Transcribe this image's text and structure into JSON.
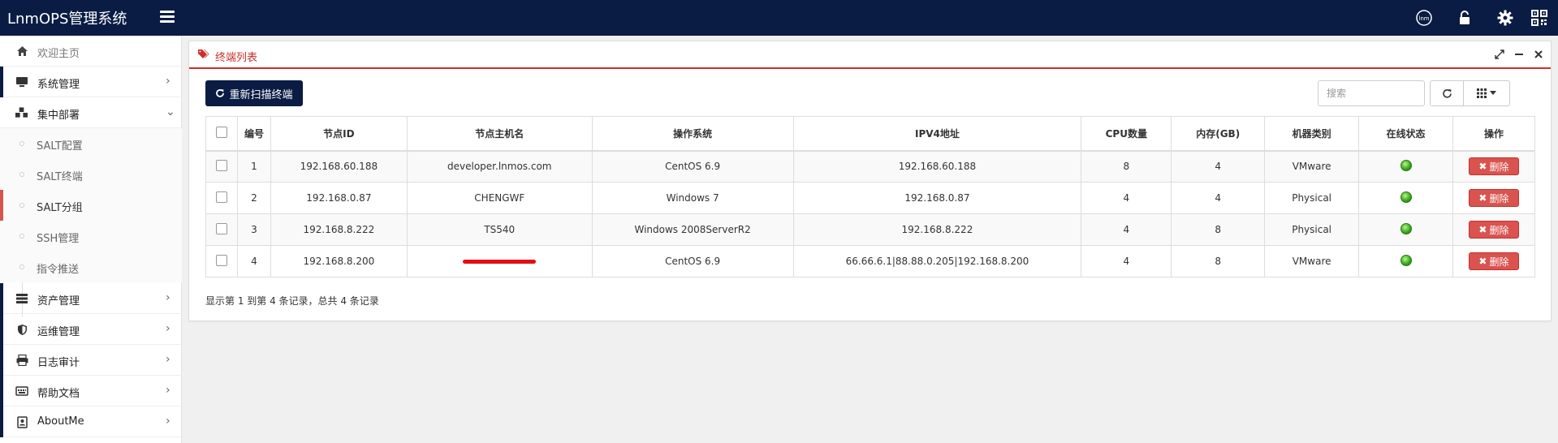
{
  "header": {
    "brand": "LnmOPS管理系统",
    "icons": [
      "logo-icon",
      "unlock-icon",
      "gear-icon",
      "qrcode-icon"
    ]
  },
  "sidebar": {
    "items": [
      {
        "label": "欢迎主页",
        "icon": "home-icon"
      },
      {
        "label": "系统管理",
        "icon": "desktop-icon"
      },
      {
        "label": "集中部署",
        "icon": "cubes-icon"
      },
      {
        "label": "资产管理",
        "icon": "server-icon"
      },
      {
        "label": "运维管理",
        "icon": "shield-icon"
      },
      {
        "label": "日志审计",
        "icon": "print-icon"
      },
      {
        "label": "帮助文档",
        "icon": "book-icon"
      },
      {
        "label": "AboutMe",
        "icon": "contact-icon"
      }
    ],
    "subitems": [
      {
        "label": "SALT配置"
      },
      {
        "label": "SALT终端"
      },
      {
        "label": "SALT分组"
      },
      {
        "label": "SSH管理"
      },
      {
        "label": "指令推送"
      }
    ]
  },
  "panel": {
    "title": "终端列表",
    "rescan_label": "重新扫描终端",
    "search_placeholder": "搜索"
  },
  "table": {
    "headers": [
      "编号",
      "节点ID",
      "节点主机名",
      "操作系统",
      "IPV4地址",
      "CPU数量",
      "内存(GB)",
      "机器类别",
      "在线状态",
      "操作"
    ],
    "delete_label": "删除",
    "rows": [
      {
        "no": "1",
        "node_id": "192.168.60.188",
        "hostname": "developer.lnmos.com",
        "os": "CentOS 6.9",
        "ipv4": "192.168.60.188",
        "cpu": "8",
        "mem": "4",
        "type": "VMware",
        "online": true
      },
      {
        "no": "2",
        "node_id": "192.168.0.87",
        "hostname": "CHENGWF",
        "os": "Windows 7",
        "ipv4": "192.168.0.87",
        "cpu": "4",
        "mem": "4",
        "type": "Physical",
        "online": true
      },
      {
        "no": "3",
        "node_id": "192.168.8.222",
        "hostname": "TS540",
        "os": "Windows 2008ServerR2",
        "ipv4": "192.168.8.222",
        "cpu": "4",
        "mem": "8",
        "type": "Physical",
        "online": true
      },
      {
        "no": "4",
        "node_id": "192.168.8.200",
        "hostname": "",
        "os": "CentOS 6.9",
        "ipv4": "66.66.6.1|88.88.0.205|192.168.8.200",
        "cpu": "4",
        "mem": "8",
        "type": "VMware",
        "online": true
      }
    ]
  },
  "footer": {
    "summary": "显示第 1 到第 4 条记录，总共 4 条记录"
  },
  "colors": {
    "topbar": "#0a1c44",
    "accent_red": "#c9302c",
    "danger": "#d9534f",
    "online": "#33a31a"
  }
}
